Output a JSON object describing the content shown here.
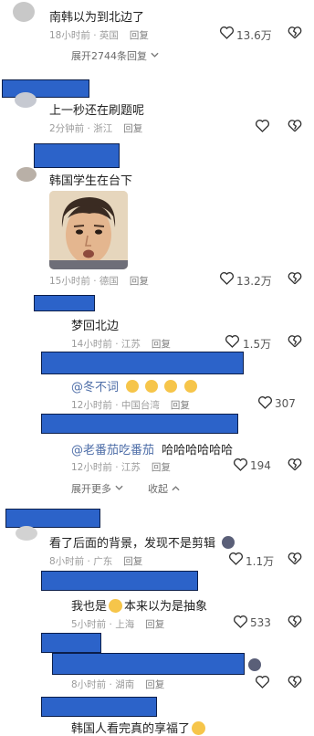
{
  "comments": [
    {
      "text": "南韩以为到北边了",
      "meta": "18小时前 · 英国",
      "reply": "回复",
      "likes": "13.6万",
      "expand": "展开2744条回复"
    },
    {
      "text": "上一秒还在刷题呢",
      "meta": "2分钟前 · 浙江",
      "reply": "回复"
    },
    {
      "text": "韩国学生在台下",
      "meta": "15小时前 · 德国",
      "reply": "回复",
      "likes": "13.2万"
    },
    {
      "text": "梦回北边",
      "meta": "14小时前 · 江苏",
      "reply": "回复",
      "likes": "1.5万"
    },
    {
      "mention": "@冬不词",
      "meta": "12小时前 · 中国台湾",
      "reply": "回复",
      "likes": "307"
    },
    {
      "mention": "@老番茄吃番茄",
      "text": "哈哈哈哈哈哈",
      "meta": "12小时前 · 江苏",
      "reply": "回复",
      "likes": "194"
    },
    {
      "text": "看了后面的背景，发现不是剪辑",
      "meta": "8小时前 · 广东",
      "reply": "回复",
      "likes": "1.1万"
    },
    {
      "text_a": "我也是",
      "text_b": "本来以为是抽象",
      "meta": "5小时前 · 上海",
      "reply": "回复",
      "likes": "533"
    },
    {
      "meta": "8小时前 · 湖南",
      "reply": "回复"
    },
    {
      "text": "韩国人看完真的享福了"
    }
  ],
  "controls": {
    "expand_more": "展开更多",
    "collapse": "收起"
  },
  "icons": {
    "like": "heart-icon",
    "dislike": "broken-heart-icon",
    "expand": "chevron-down-icon",
    "collapse": "chevron-up-icon"
  },
  "colors": {
    "redaction": "#2c63c9",
    "mention": "#4e6ea8"
  }
}
